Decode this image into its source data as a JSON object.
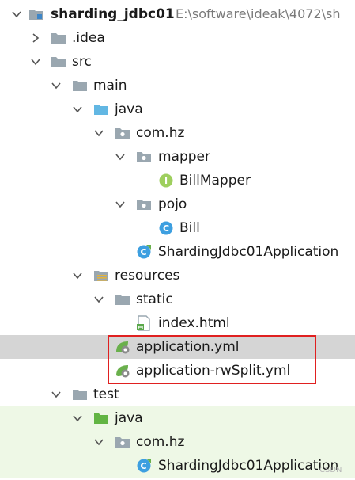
{
  "project": {
    "name": "sharding_jdbc01",
    "path": "E:\\software\\ideak\\4072\\sh"
  },
  "tree": {
    "idea": ".idea",
    "src": "src",
    "main": "main",
    "java_main": "java",
    "package_main": "com.hz",
    "mapper": "mapper",
    "bill_mapper": "BillMapper",
    "pojo": "pojo",
    "bill": "Bill",
    "app_main": "ShardingJdbc01Application",
    "resources": "resources",
    "static": "static",
    "index_html": "index.html",
    "application_yml": "application.yml",
    "application_rwsplit_yml": "application-rwSplit.yml",
    "test": "test",
    "java_test": "java",
    "package_test": "com.hz",
    "app_test": "ShardingJdbc01Application"
  },
  "icon_letters": {
    "interface": "I",
    "class": "C"
  },
  "watermark": "CSDN"
}
